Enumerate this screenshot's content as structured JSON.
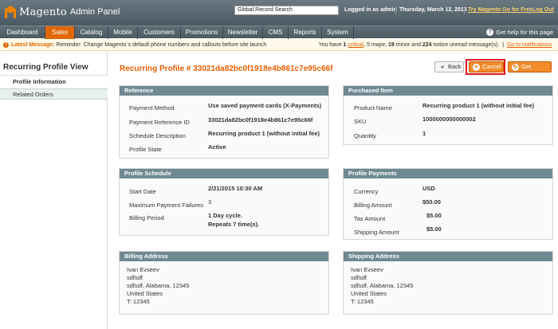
{
  "header": {
    "logo_text": "Magento",
    "logo_sub": "Admin Panel",
    "global_search": "Global Record Search",
    "logged_in": "Logged in as admin",
    "date": "Thursday, March 12, 2015",
    "go_free": "Try Magento Go for Free",
    "logout": "Log Out"
  },
  "nav": {
    "items": [
      "Dashboard",
      "Sales",
      "Catalog",
      "Mobile",
      "Customers",
      "Promotions",
      "Newsletter",
      "CMS",
      "Reports",
      "System"
    ],
    "help": "Get help for this page"
  },
  "message": {
    "latest_label": "Latest Message:",
    "latest_text": "Reminder: Change Magento`s default phone numbers and callouts before site launch",
    "summary_prefix": "You have",
    "critical_count": "1",
    "critical_label": "critical",
    "major": "5 major,",
    "minor_count": "19",
    "minor_label": "minor and",
    "notice_count": "224",
    "notice_label": "notice unread message(s).",
    "go_notifications": "Go to notifications"
  },
  "sidebar": {
    "title": "Recurring Profile View",
    "tabs": [
      "Profile Information",
      "Related Orders"
    ]
  },
  "page": {
    "title": "Recurring Profile # 33021da82bc0f1918e4b861c7e95c66f",
    "back": "Back",
    "cancel": "Cancel",
    "update": "Get Update"
  },
  "reference": {
    "title": "Reference",
    "labels": [
      "Payment Method",
      "Payment Reference ID",
      "Schedule Description",
      "Profile State"
    ],
    "values": [
      "Use saved payment cards (X-Payments)",
      "33021da82bc0f1918e4b861c7e95c66f",
      "Recurring product 1 (without initial fee)",
      "Active"
    ]
  },
  "purchased": {
    "title": "Purchased Item",
    "labels": [
      "Product Name",
      "SKU",
      "Quantity"
    ],
    "values": [
      "Recurring product 1 (without initial fee)",
      "1000000000000002",
      "1"
    ]
  },
  "schedule": {
    "title": "Profile Schedule",
    "labels": [
      "Start Date",
      "Maximum Payment Failures",
      "Billing Period"
    ],
    "values": [
      "2/21/2015 10:30 AM",
      "3",
      "1 Day cycle.",
      "Repeats 7 time(s)."
    ]
  },
  "payments": {
    "title": "Profile Payments",
    "labels": [
      "Currency",
      "Billing Amount",
      "Tax Amount",
      "Shipping Amount"
    ],
    "values": [
      "USD",
      "$50.00",
      "$5.00",
      "$5.00"
    ]
  },
  "billing": {
    "title": "Billing Address",
    "lines": [
      "Ivan Evseev",
      "sdfsdf",
      "sdfsdf, Alabama, 12345",
      "United States",
      "T: 12345"
    ]
  },
  "shipping": {
    "title": "Shipping Address",
    "lines": [
      "Ivan Evseev",
      "sdfsdf",
      "sdfsdf, Alabama, 12345",
      "United States",
      "T: 12345"
    ]
  },
  "colors": {
    "accent": "#eb5e00",
    "nav_active": "#e26703",
    "box_header": "#6f8992",
    "highlight": "#e0161c"
  }
}
